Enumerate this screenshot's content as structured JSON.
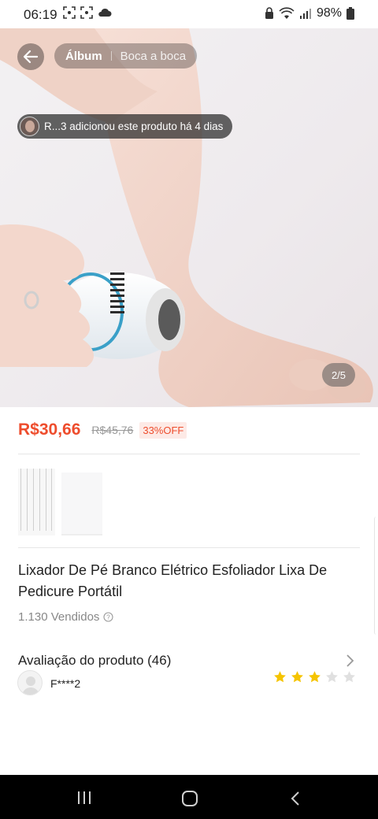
{
  "status_bar": {
    "time": "06:19",
    "battery": "98%"
  },
  "top_bar": {
    "tab_album": "Álbum",
    "tab_word_of_mouth": "Boca a boca"
  },
  "notice": {
    "text": "R...3 adicionou este produto há 4 dias"
  },
  "gallery": {
    "counter": "2/5"
  },
  "product": {
    "price": "R$30,66",
    "original_price": "R$45,76",
    "discount": "33%OFF",
    "title": "Lixador De Pé Branco Elétrico Esfoliador Lixa De Pedicure Portátil",
    "sold": "1.130 Vendidos"
  },
  "rating": {
    "header": "Avaliação do produto (46)",
    "reviewer": "F****2",
    "stars_filled": 3,
    "stars_total": 5,
    "star_color": "#f5c400",
    "star_empty_color": "#e0e0e0"
  },
  "colors": {
    "accent": "#ee4d2d"
  },
  "icons": [
    "back-arrow-icon",
    "info-icon",
    "chevron-right-icon",
    "star-icon",
    "recents-icon",
    "home-icon",
    "back-icon"
  ]
}
